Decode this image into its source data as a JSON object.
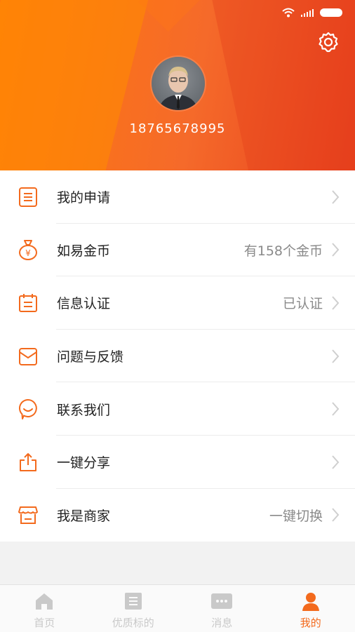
{
  "header": {
    "phone": "18765678995"
  },
  "menu": {
    "items": [
      {
        "label": "我的申请",
        "value": "",
        "icon": "document-list-icon"
      },
      {
        "label": "如易金币",
        "value": "有158个金币",
        "icon": "money-bag-icon"
      },
      {
        "label": "信息认证",
        "value": "已认证",
        "icon": "calendar-check-icon"
      },
      {
        "label": "问题与反馈",
        "value": "",
        "icon": "envelope-icon"
      },
      {
        "label": "联系我们",
        "value": "",
        "icon": "chat-smile-icon"
      },
      {
        "label": "一键分享",
        "value": "",
        "icon": "share-icon"
      },
      {
        "label": "我是商家",
        "value": "一键切换",
        "icon": "storefront-icon"
      }
    ]
  },
  "tabbar": {
    "tabs": [
      {
        "label": "首页",
        "icon": "home-icon"
      },
      {
        "label": "优质标的",
        "icon": "list-icon"
      },
      {
        "label": "消息",
        "icon": "message-icon"
      },
      {
        "label": "我的",
        "icon": "user-icon"
      }
    ],
    "active_index": 3
  },
  "colors": {
    "accent": "#f36a1d",
    "header_start": "#ff7a0c",
    "header_end": "#e8401e",
    "inactive_tab": "#c9c9c9"
  }
}
